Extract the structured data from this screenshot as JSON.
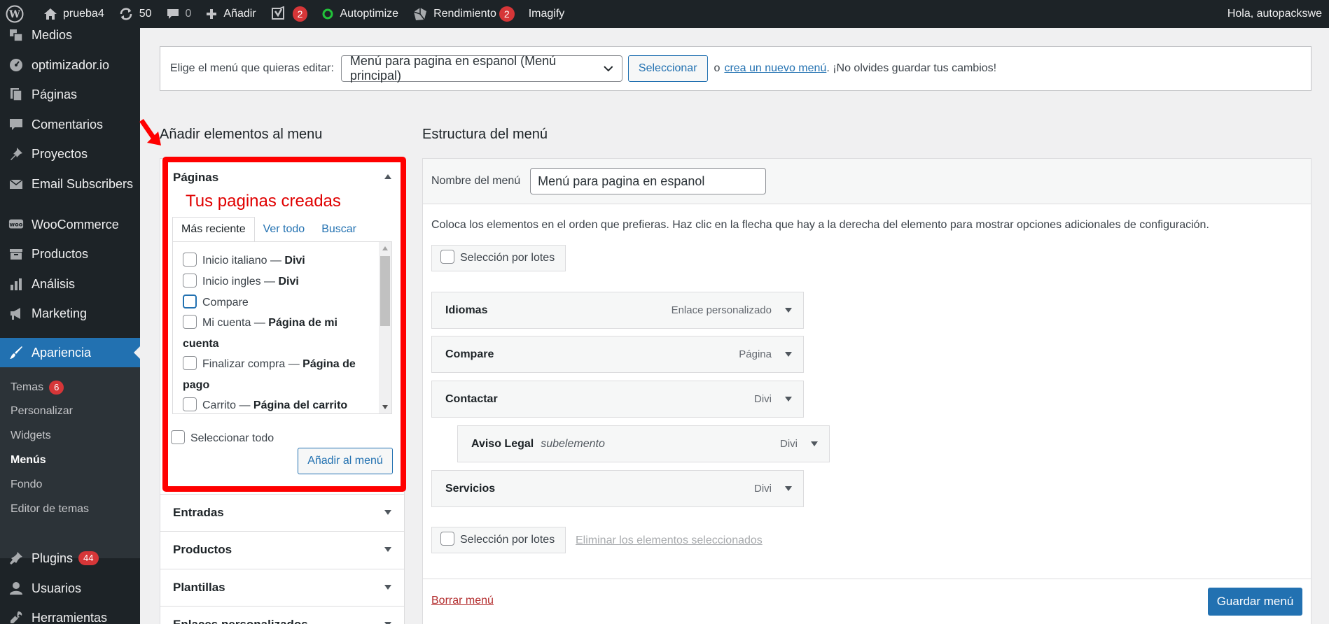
{
  "adminbar": {
    "site_name": "prueba4",
    "updates_count": "50",
    "comments_count": "0",
    "new_label": "Añadir",
    "yoast_badge": "2",
    "autoptimize_label": "Autoptimize",
    "performance_label": "Rendimiento",
    "performance_badge": "2",
    "imagify_label": "Imagify",
    "greeting": "Hola, autopackswe"
  },
  "sidebar": {
    "items": [
      {
        "label": "Medios",
        "icon": "media-icon"
      },
      {
        "label": "optimizador.io",
        "icon": "speed-icon"
      },
      {
        "label": "Páginas",
        "icon": "pages-icon"
      },
      {
        "label": "Comentarios",
        "icon": "comments-icon"
      },
      {
        "label": "Proyectos",
        "icon": "pin-icon"
      },
      {
        "label": "Email Subscribers",
        "icon": "email-icon"
      },
      {
        "label": "WooCommerce",
        "icon": "woocommerce-icon"
      },
      {
        "label": "Productos",
        "icon": "products-icon"
      },
      {
        "label": "Análisis",
        "icon": "analytics-icon"
      },
      {
        "label": "Marketing",
        "icon": "megaphone-icon"
      },
      {
        "label": "Apariencia",
        "icon": "brush-icon"
      },
      {
        "label": "Plugins",
        "icon": "plugin-icon",
        "badge": "44"
      },
      {
        "label": "Usuarios",
        "icon": "user-icon"
      },
      {
        "label": "Herramientas",
        "icon": "wrench-icon"
      }
    ],
    "submenu": [
      {
        "label": "Temas",
        "badge": "6"
      },
      {
        "label": "Personalizar"
      },
      {
        "label": "Widgets"
      },
      {
        "label": "Menús"
      },
      {
        "label": "Fondo"
      },
      {
        "label": "Editor de temas"
      }
    ]
  },
  "manage": {
    "label": "Elige el menú que quieras editar:",
    "selected_menu": "Menú para pagina en espanol (Menú principal)",
    "select_button": "Seleccionar",
    "or_text": "o",
    "create_link": "crea un nuevo menú",
    "reminder": ". ¡No olvides guardar tus cambios!"
  },
  "left": {
    "heading": "Añadir elementos al menu",
    "annotation": "Tus paginas creadas",
    "sections": [
      "Páginas",
      "Entradas",
      "Productos",
      "Plantillas",
      "Enlaces personalizados"
    ],
    "tabs": [
      "Más reciente",
      "Ver todo",
      "Buscar"
    ],
    "pages": [
      {
        "title": "Inicio italiano",
        "suffix": "Divi"
      },
      {
        "title": "Inicio ingles",
        "suffix": "Divi"
      },
      {
        "title": "Compare",
        "suffix": ""
      },
      {
        "title": "Mi cuenta",
        "suffix": "Página de mi cuenta"
      },
      {
        "title": "Finalizar compra",
        "suffix": "Página de pago"
      },
      {
        "title": "Carrito",
        "suffix": "Página del carrito"
      }
    ],
    "dash": " — ",
    "select_all": "Seleccionar todo",
    "add_button": "Añadir al menú"
  },
  "right": {
    "heading": "Estructura del menú",
    "name_label": "Nombre del menú",
    "name_value": "Menú para pagina en espanol",
    "instructions": "Coloca los elementos en el orden que prefieras. Haz clic en la flecha que hay a la derecha del elemento para mostrar opciones adicionales de configuración.",
    "bulk_select": "Selección por lotes",
    "items": [
      {
        "title": "Idiomas",
        "type": "Enlace personalizado",
        "sub": ""
      },
      {
        "title": "Compare",
        "type": "Página",
        "sub": ""
      },
      {
        "title": "Contactar",
        "type": "Divi",
        "sub": ""
      },
      {
        "title": "Aviso Legal",
        "type": "Divi",
        "sub": "subelemento"
      },
      {
        "title": "Servicios",
        "type": "Divi",
        "sub": ""
      }
    ],
    "delete_selected": "Eliminar los elementos seleccionados",
    "delete_menu": "Borrar menú",
    "save_menu": "Guardar menú"
  }
}
